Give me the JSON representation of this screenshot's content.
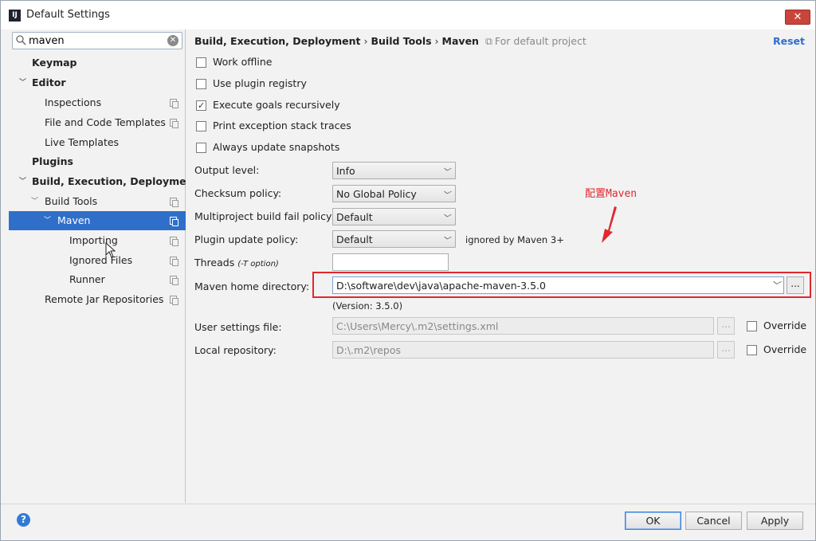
{
  "window": {
    "title": "Default Settings",
    "app_icon": "IJ"
  },
  "sidebar": {
    "search": {
      "value": "maven"
    },
    "items": [
      {
        "label": "Keymap"
      },
      {
        "label": "Editor"
      },
      {
        "label": "Inspections"
      },
      {
        "label": "File and Code Templates"
      },
      {
        "label": "Live Templates"
      },
      {
        "label": "Plugins"
      },
      {
        "label": "Build, Execution, Deployment"
      },
      {
        "label": "Build Tools"
      },
      {
        "label": "Maven"
      },
      {
        "label": "Importing"
      },
      {
        "label": "Ignored Files"
      },
      {
        "label": "Runner"
      },
      {
        "label": "Remote Jar Repositories"
      }
    ]
  },
  "header": {
    "crumbs": [
      "Build, Execution, Deployment",
      "Build Tools",
      "Maven"
    ],
    "separator": "›",
    "note": "For default project",
    "reset": "Reset"
  },
  "options": [
    {
      "label": "Work offline",
      "checked": false
    },
    {
      "label": "Use plugin registry",
      "checked": false
    },
    {
      "label": "Execute goals recursively",
      "checked": true
    },
    {
      "label": "Print exception stack traces",
      "checked": false
    },
    {
      "label": "Always update snapshots",
      "checked": false
    }
  ],
  "fields": {
    "output_level": {
      "label": "Output level:",
      "value": "Info"
    },
    "checksum_policy": {
      "label": "Checksum policy:",
      "value": "No Global Policy"
    },
    "fail_policy": {
      "label": "Multiproject build fail policy:",
      "value": "Default"
    },
    "plugin_update": {
      "label": "Plugin update policy:",
      "value": "Default",
      "note": "ignored by Maven 3+"
    },
    "threads": {
      "label": "Threads",
      "hint": "(-T option)",
      "value": ""
    },
    "maven_home": {
      "label": "Maven home directory:",
      "value": "D:\\software\\dev\\java\\apache-maven-3.5.0",
      "version": "(Version: 3.5.0)",
      "browse": "..."
    },
    "user_settings": {
      "label": "User settings file:",
      "value": "C:\\Users\\Mercy\\.m2\\settings.xml",
      "browse": "...",
      "override": "Override"
    },
    "local_repo": {
      "label": "Local repository:",
      "value": "D:\\.m2\\repos",
      "browse": "...",
      "override": "Override"
    }
  },
  "annotation": {
    "text": "配置Maven",
    "color": "#e0282e"
  },
  "footer": {
    "help": "?",
    "ok": "OK",
    "cancel": "Cancel",
    "apply": "Apply"
  },
  "colors": {
    "selection": "#2f6fca",
    "link": "#2f6fca",
    "highlight": "#e0282e"
  }
}
